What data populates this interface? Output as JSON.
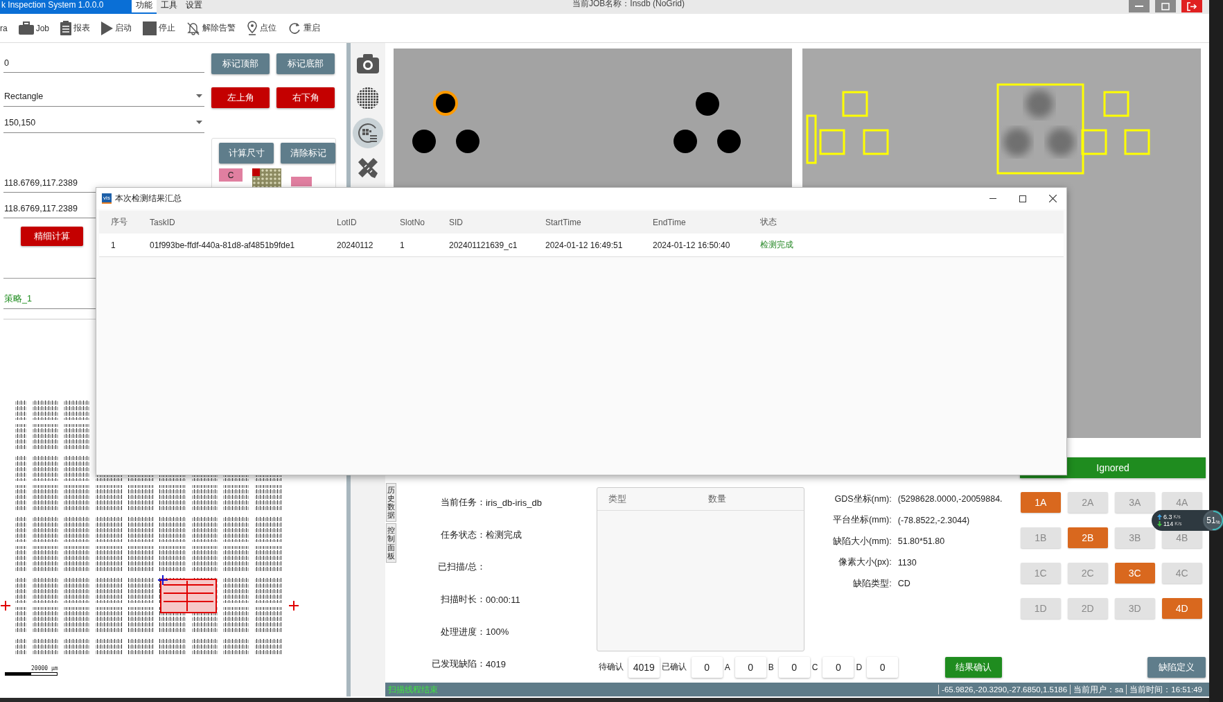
{
  "app": {
    "title_tab": "k Inspection System 1.0.0.0",
    "menu": [
      {
        "label": "功能",
        "selected": true
      },
      {
        "label": "工具",
        "selected": false
      },
      {
        "label": "设置",
        "selected": false
      }
    ],
    "job_title": "当前JOB名称：Insdb (NoGrid)"
  },
  "toolbar": [
    {
      "label": "ra",
      "kind": "none"
    },
    {
      "label": "Job",
      "kind": "briefcase"
    },
    {
      "label": "报表",
      "kind": "report"
    },
    {
      "label": "启动",
      "kind": "play"
    },
    {
      "label": "停止",
      "kind": "stop"
    },
    {
      "label": "解除告警",
      "kind": "bell-off"
    },
    {
      "label": "点位",
      "kind": "pin"
    },
    {
      "label": "重启",
      "kind": "refresh"
    }
  ],
  "left_panel": {
    "mark_field": {
      "value": "0"
    },
    "mark_buttons": [
      "标记顶部",
      "标记底部"
    ],
    "shape_select": {
      "value": "Rectangle"
    },
    "corner_buttons": [
      "左上角",
      "右下角"
    ],
    "size_select": {
      "value": "150,150"
    },
    "calc_buttons": [
      "计算尺寸",
      "清除标记"
    ],
    "tag": "C",
    "coord_fields": [
      {
        "value": "118.6769,117.2389"
      },
      {
        "value": "118.6769,117.2389"
      }
    ],
    "fine_calc_button": "精细计算",
    "strategy_field": {
      "value": "策略_1"
    },
    "scale_label": "20000 μm"
  },
  "side_tools": [
    {
      "kind": "camera",
      "selected": false
    },
    {
      "kind": "grid",
      "selected": false
    },
    {
      "kind": "wafer",
      "selected": true
    },
    {
      "kind": "ruler",
      "selected": false
    }
  ],
  "dialog": {
    "badge": "vis",
    "title": "本次检测结果汇总",
    "columns": [
      "序号",
      "TaskID",
      "LotID",
      "SlotNo",
      "SID",
      "StartTime",
      "EndTime",
      "状态"
    ],
    "rows": [
      {
        "cells": [
          "1",
          "01f993be-ffdf-440a-81d8-af4851b9fde1",
          "20240112",
          "1",
          "202401121639_c1",
          "2024-01-12 16:49:51",
          "2024-01-12 16:50:40"
        ],
        "status": {
          "text": "检测完成",
          "kind": "done"
        }
      }
    ]
  },
  "ignored_bar": "Ignored",
  "vertical_tabs": [
    "历史数据",
    "控制面板"
  ],
  "task_info": [
    {
      "label": "当前任务：",
      "value": "iris_db-iris_db"
    },
    {
      "label": "任务状态：",
      "value": "检测完成"
    },
    {
      "label": "已扫描/总："
    },
    {
      "label": "扫描时长：",
      "value": "00:00:11"
    },
    {
      "label": "处理进度：",
      "value": "100%"
    },
    {
      "label": "已发现缺陷：",
      "value": "4019"
    }
  ],
  "type_table": {
    "columns": [
      "类型",
      "数量"
    ]
  },
  "counts": [
    {
      "label": "待确认",
      "value": "4019"
    },
    {
      "label": "已确认",
      "value": "0"
    },
    {
      "label": "A",
      "value": "0"
    },
    {
      "label": "B",
      "value": "0"
    },
    {
      "label": "C",
      "value": "0"
    },
    {
      "label": "D",
      "value": "0"
    }
  ],
  "confirm_button": "结果确认",
  "defect_info": [
    {
      "label": "GDS坐标(nm):",
      "value": "(5298628.0000,-20059884."
    },
    {
      "label": "平台坐标(mm):",
      "value": "(-78.8522,-2.3044)"
    },
    {
      "label": "缺陷大小(mm):",
      "value": "51.80*51.80"
    },
    {
      "label": "像素大小(px):",
      "value": "1130"
    },
    {
      "label": "缺陷类型:",
      "value": "CD"
    }
  ],
  "grade_grid": [
    {
      "label": "1A",
      "selected": true
    },
    {
      "label": "2A",
      "selected": false
    },
    {
      "label": "3A",
      "selected": false
    },
    {
      "label": "4A",
      "selected": false
    },
    {
      "label": "1B",
      "selected": false
    },
    {
      "label": "2B",
      "selected": true
    },
    {
      "label": "3B",
      "selected": false
    },
    {
      "label": "4B",
      "selected": false
    },
    {
      "label": "1C",
      "selected": false
    },
    {
      "label": "2C",
      "selected": false
    },
    {
      "label": "3C",
      "selected": true
    },
    {
      "label": "4C",
      "selected": false
    },
    {
      "label": "1D",
      "selected": false
    },
    {
      "label": "2D",
      "selected": false
    },
    {
      "label": "3D",
      "selected": false
    },
    {
      "label": "4D",
      "selected": true
    }
  ],
  "define_button": "缺陷定义",
  "status_bar": {
    "message": "扫描线程结束",
    "coords": "-65.9826,-20.3290,-27.6850,1.5186",
    "user": "当前用户：sa",
    "time": "当前时间：16:51:49"
  },
  "net_widget": {
    "up": {
      "value": "6.3",
      "unit": "K/s"
    },
    "down": {
      "value": "114",
      "unit": "K/s"
    },
    "load": "51",
    "load_unit": "%"
  }
}
